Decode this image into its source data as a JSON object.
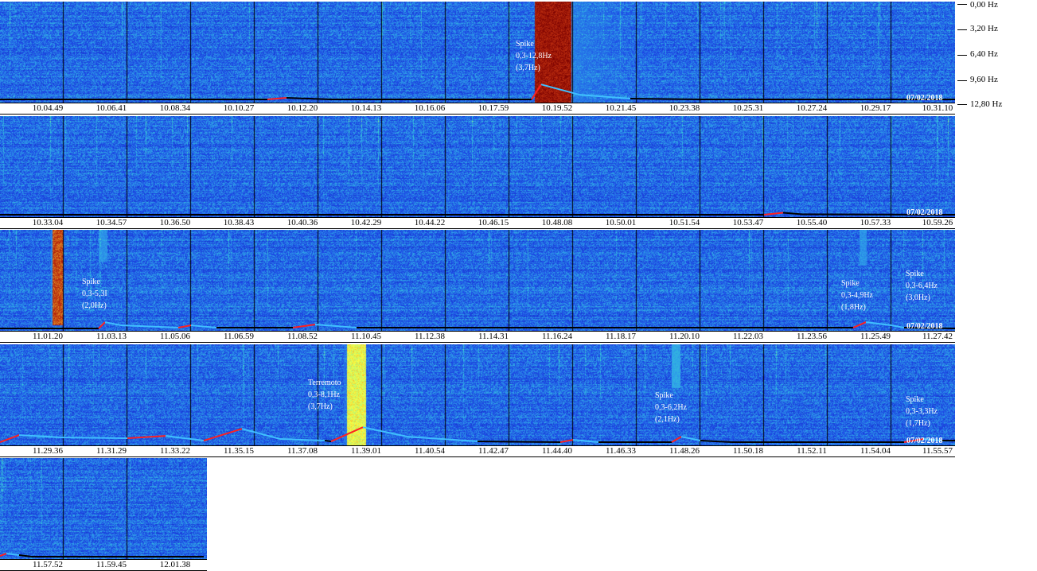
{
  "freq_axis": {
    "labels": [
      "0,00 Hz",
      "3,20 Hz",
      "6,40 Hz",
      "9,60 Hz",
      "12,80 Hz"
    ]
  },
  "chart_data": {
    "type": "heatmap",
    "title": "",
    "xlabel": "",
    "ylabel": "",
    "ylim": [
      0,
      12.8
    ],
    "y_unit": "Hz",
    "colormap": [
      "#0a1590",
      "#1d47e6",
      "#2fa3e8",
      "#3ae3c8",
      "#ffff40",
      "#c03010",
      "#7a0000"
    ],
    "trace_colors": {
      "baseline": "#000000",
      "rise": "#ff2020",
      "decay": "#40c0ff"
    },
    "rows": [
      {
        "ticks": [
          "10.04.49",
          "10.06.41",
          "10.08.34",
          "10.10.27",
          "10.12.20",
          "10.14.13",
          "10.16.06",
          "10.17.59",
          "10.19.52",
          "10.21.45",
          "10.23.38",
          "10.25.31",
          "10.27.24",
          "10.29.17",
          "10.31.10"
        ],
        "date": "07/02/2018",
        "annotations": [
          {
            "lines": [
              "Spike",
              "0,3-12,8Hz",
              "(3,7Hz)"
            ]
          }
        ],
        "events": [
          {
            "start": 8.4,
            "peak": 8.55,
            "end": 11.2,
            "fmax": 12.8,
            "intensity": 1.0
          }
        ],
        "trace": [
          [
            0,
            0.3
          ],
          [
            4.2,
            0.3
          ],
          [
            4.5,
            0.5
          ],
          [
            5.2,
            0.3
          ],
          [
            8.35,
            0.3
          ],
          [
            8.5,
            2.2
          ],
          [
            9.1,
            0.9
          ],
          [
            9.9,
            0.4
          ],
          [
            11,
            0.3
          ],
          [
            15,
            0.3
          ]
        ]
      },
      {
        "ticks": [
          "10.33.04",
          "10.34.57",
          "10.36.50",
          "10.38.43",
          "10.40.36",
          "10.42.29",
          "10.44.22",
          "10.46.15",
          "10.48.08",
          "10.50.01",
          "10.51.54",
          "10.53.47",
          "10.55.40",
          "10.57.33",
          "10.59.26"
        ],
        "date": "07/02/2018",
        "annotations": [],
        "events": [],
        "trace": [
          [
            0,
            0.2
          ],
          [
            12,
            0.2
          ],
          [
            12.3,
            0.45
          ],
          [
            12.6,
            0.25
          ],
          [
            15,
            0.2
          ]
        ]
      },
      {
        "ticks": [
          "11.01.20",
          "11.03.13",
          "11.05.06",
          "11.06.59",
          "11.08.52",
          "11.10.45",
          "11.12.38",
          "11.14.31",
          "11.16.24",
          "11.18.17",
          "11.20.10",
          "11.22.03",
          "11.23.56",
          "11.25.49",
          "11.27.42"
        ],
        "date": "07/02/2018",
        "annotations": [
          {
            "lines": [
              "Spike",
              "0,3-5,3I",
              "(2,0Hz)"
            ]
          },
          {
            "lines": [
              "Spike",
              "0,3-4,9Hz",
              "(1,8Hz)"
            ]
          },
          {
            "lines": [
              "Spike",
              "0,3-6,4Hz",
              "(3,0Hz)"
            ]
          }
        ],
        "events": [
          {
            "start": 0.8,
            "peak": 0.9,
            "end": 1.0,
            "fmax": 12.0,
            "intensity": 0.95
          },
          {
            "start": 1.55,
            "peak": 1.6,
            "end": 1.7,
            "fmax": 4.0,
            "intensity": 0.55
          },
          {
            "start": 13.5,
            "peak": 13.55,
            "end": 13.6,
            "fmax": 4.5,
            "intensity": 0.55
          }
        ],
        "trace": [
          [
            0,
            0.2
          ],
          [
            1.55,
            0.2
          ],
          [
            1.65,
            1.0
          ],
          [
            1.9,
            0.6
          ],
          [
            2.8,
            0.3
          ],
          [
            3.0,
            0.6
          ],
          [
            3.4,
            0.3
          ],
          [
            4.6,
            0.3
          ],
          [
            4.95,
            0.7
          ],
          [
            5.6,
            0.3
          ],
          [
            13.4,
            0.3
          ],
          [
            13.6,
            1.0
          ],
          [
            14.0,
            0.6
          ],
          [
            14.2,
            0.3
          ],
          [
            15,
            0.2
          ]
        ]
      },
      {
        "ticks": [
          "11.29.36",
          "11.31.29",
          "11.33.22",
          "11.35.15",
          "11.37.08",
          "11.39.01",
          "11.40.54",
          "11.42.47",
          "11.44.40",
          "11.46.33",
          "11.48.26",
          "11.50.18",
          "11.52.11",
          "11.54.04",
          "11.55.57"
        ],
        "date": "07/02/2018",
        "annotations": [
          {
            "lines": [
              "Terremoto",
              "0,3-8,1Hz",
              "(3,7Hz)"
            ]
          },
          {
            "lines": [
              "Spike",
              "0,3-6,2Hz",
              "(2,1Hz)"
            ]
          },
          {
            "lines": [
              "Spike",
              "0,3-3,3Hz",
              "(1,7Hz)"
            ]
          }
        ],
        "events": [
          {
            "start": 5.4,
            "peak": 5.6,
            "end": 6.4,
            "fmax": 12.8,
            "intensity": 0.85
          },
          {
            "start": 10.55,
            "peak": 10.6,
            "end": 10.7,
            "fmax": 5.5,
            "intensity": 0.6
          }
        ],
        "trace": [
          [
            0,
            0.3
          ],
          [
            0.3,
            1.2
          ],
          [
            1.0,
            0.9
          ],
          [
            2.0,
            0.8
          ],
          [
            2.6,
            1.1
          ],
          [
            3.2,
            0.5
          ],
          [
            3.8,
            2.0
          ],
          [
            4.4,
            0.7
          ],
          [
            5.1,
            0.5
          ],
          [
            5.2,
            0.4
          ],
          [
            5.7,
            2.2
          ],
          [
            6.4,
            1.0
          ],
          [
            7.5,
            0.4
          ],
          [
            8.8,
            0.3
          ],
          [
            9.0,
            0.6
          ],
          [
            9.4,
            0.3
          ],
          [
            10.55,
            0.3
          ],
          [
            10.7,
            1.0
          ],
          [
            11.0,
            0.5
          ],
          [
            11.5,
            0.3
          ],
          [
            14.2,
            0.3
          ],
          [
            14.5,
            0.7
          ],
          [
            14.8,
            0.5
          ],
          [
            15,
            0.5
          ]
        ]
      },
      {
        "ticks": [
          "11.57.52",
          "11.59.45",
          "12.01.38"
        ],
        "date": "",
        "annotations": [],
        "events": [],
        "trace": [
          [
            0,
            0.3
          ],
          [
            0.1,
            0.6
          ],
          [
            0.3,
            0.4
          ],
          [
            0.5,
            0.2
          ],
          [
            3.2,
            0.2
          ]
        ]
      }
    ]
  }
}
